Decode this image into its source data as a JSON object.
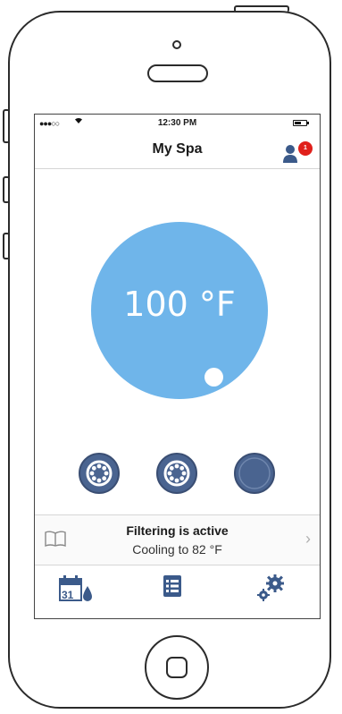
{
  "status_bar": {
    "signal": "●●●○○",
    "time": "12:30 PM"
  },
  "header": {
    "title": "My Spa",
    "notification_count": "1"
  },
  "temperature": {
    "display": "100 °F"
  },
  "jets": [
    {
      "name": "jet-1"
    },
    {
      "name": "jet-2"
    },
    {
      "name": "jet-3"
    }
  ],
  "status": {
    "line1": "Filtering is active",
    "line2": "Cooling to 82 °F"
  },
  "tabbar": {
    "calendar_day": "31"
  },
  "colors": {
    "dial": "#6fb5ea",
    "jet": "#4a6490",
    "badge": "#e0201b",
    "icon_blue": "#3b5a8a"
  },
  "icons": [
    "book-icon",
    "profile-icon",
    "calendar-icon",
    "list-icon",
    "gears-icon",
    "chevron-right-icon",
    "wifi-icon",
    "battery-icon"
  ]
}
